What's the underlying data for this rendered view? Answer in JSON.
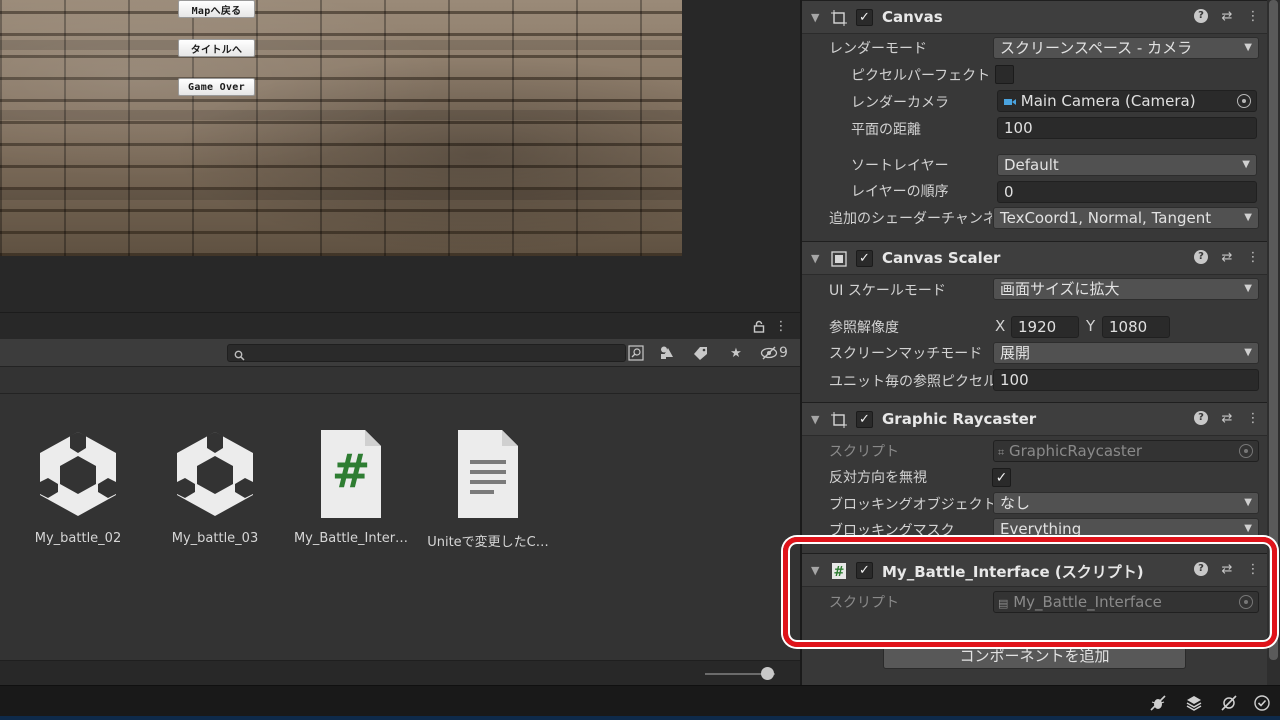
{
  "game_view": {
    "buttons": [
      "Mapへ戻る",
      "タイトルへ",
      "Game Over"
    ]
  },
  "project": {
    "search": {
      "value": "",
      "placeholder": ""
    },
    "hidden_count": "9",
    "assets": [
      {
        "label": "My_battle_02",
        "icon": "unity-prefab-icon"
      },
      {
        "label": "My_battle_03",
        "icon": "unity-prefab-icon"
      },
      {
        "label": "My_Battle_Inter…",
        "icon": "csharp-script-icon"
      },
      {
        "label": "Uniteで変更したC…",
        "icon": "text-document-icon"
      }
    ],
    "script_glyph": "#"
  },
  "inspector": {
    "canvas": {
      "title": "Canvas",
      "render_mode_label": "レンダーモード",
      "render_mode_value": "スクリーンスペース - カメラ",
      "pixel_perfect_label": "ピクセルパーフェクト",
      "render_camera_label": "レンダーカメラ",
      "render_camera_value": "Main Camera (Camera)",
      "plane_distance_label": "平面の距離",
      "plane_distance_value": "100",
      "sort_layer_label": "ソートレイヤー",
      "sort_layer_value": "Default",
      "order_label": "レイヤーの順序",
      "order_value": "0",
      "shader_channels_label": "追加のシェーダーチャンネル",
      "shader_channels_value": "TexCoord1, Normal, Tangent"
    },
    "canvas_scaler": {
      "title": "Canvas Scaler",
      "ui_scale_mode_label": "UI スケールモード",
      "ui_scale_mode_value": "画面サイズに拡大",
      "reference_resolution_label": "参照解像度",
      "x_label": "X",
      "x_value": "1920",
      "y_label": "Y",
      "y_value": "1080",
      "screen_match_label": "スクリーンマッチモード",
      "screen_match_value": "展開",
      "ref_pixels_label": "ユニット毎の参照ピクセル数",
      "ref_pixels_value": "100"
    },
    "graphic_raycaster": {
      "title": "Graphic Raycaster",
      "script_label": "スクリプト",
      "script_value": "GraphicRaycaster",
      "ignore_reversed_label": "反対方向を無視",
      "blocking_objects_label": "ブロッキングオブジェクト",
      "blocking_objects_value": "なし",
      "blocking_mask_label": "ブロッキングマスク",
      "blocking_mask_value": "Everything"
    },
    "my_battle_interface": {
      "title": "My_Battle_Interface (スクリプト)",
      "script_label": "スクリプト",
      "script_value": "My_Battle_Interface"
    },
    "add_component_label": "コンポーネントを追加",
    "checkmark": "✓",
    "caret": "▼",
    "fold": "▼"
  },
  "colors": {
    "highlight": "#e0141b",
    "script_green": "#2e7d32"
  }
}
